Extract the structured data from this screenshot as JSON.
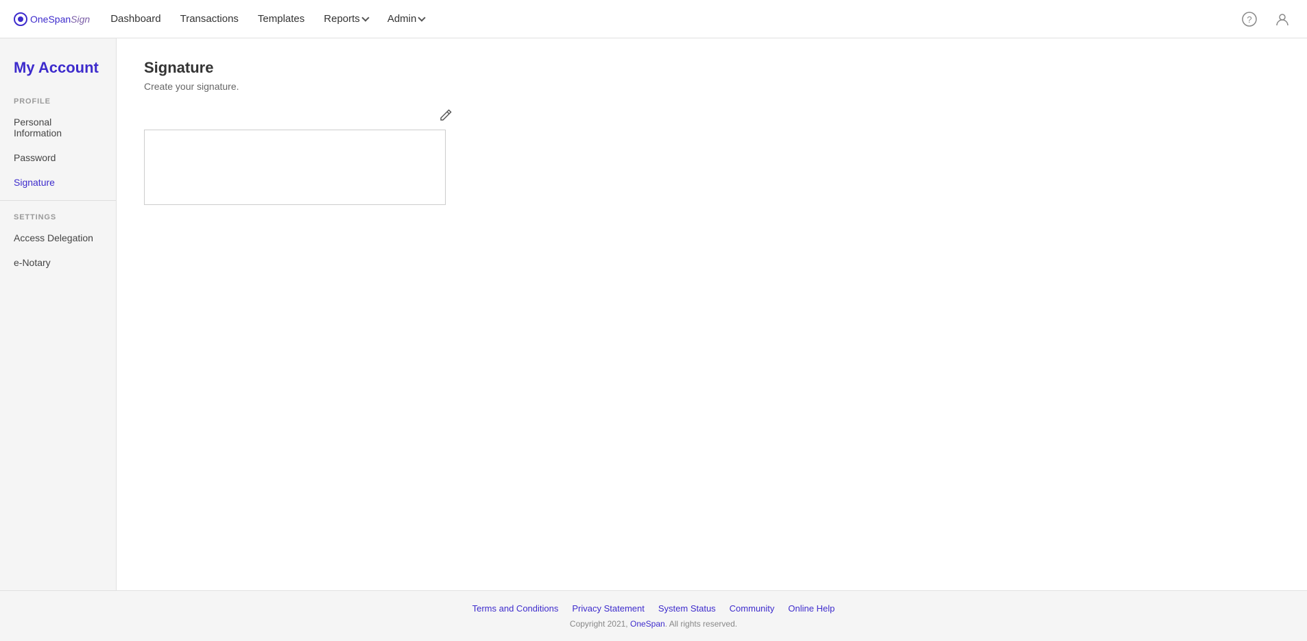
{
  "brand": {
    "onespan": "OneSpan",
    "sign": "Sign",
    "logo_aria": "OneSpan Sign Logo"
  },
  "nav": {
    "dashboard": "Dashboard",
    "transactions": "Transactions",
    "templates": "Templates",
    "reports": "Reports",
    "admin": "Admin"
  },
  "sidebar": {
    "my_account": "My Account",
    "profile_section": "PROFILE",
    "personal_information": "Personal Information",
    "password": "Password",
    "signature": "Signature",
    "settings_section": "SETTINGS",
    "access_delegation": "Access Delegation",
    "e_notary": "e-Notary"
  },
  "content": {
    "page_title": "Signature",
    "page_subtitle": "Create your signature."
  },
  "footer": {
    "terms": "Terms and Conditions",
    "privacy": "Privacy Statement",
    "system_status": "System Status",
    "community": "Community",
    "online_help": "Online Help",
    "copyright": "Copyright 2021, OneSpan. All rights reserved."
  }
}
